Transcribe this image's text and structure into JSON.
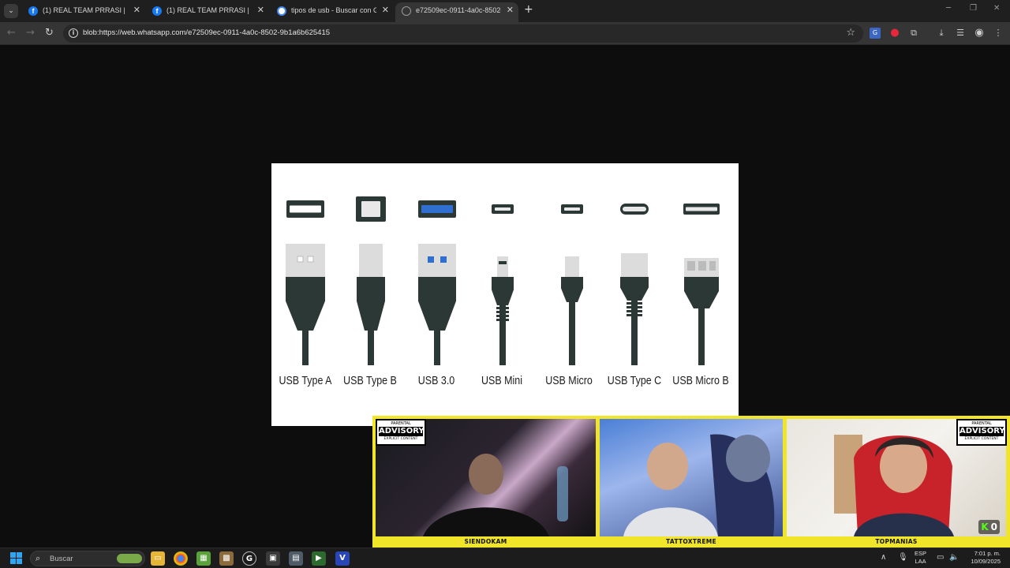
{
  "browser": {
    "tabs": [
      {
        "label": "(1) REAL TEAM PRRASI | Facebook",
        "favicon": "facebook-icon"
      },
      {
        "label": "(1) REAL TEAM PRRASI | Facebook",
        "favicon": "facebook-icon"
      },
      {
        "label": "tipos de usb - Buscar con Google",
        "favicon": "google-icon"
      },
      {
        "label": "e72509ec-0911-4a0c-8502-9b1a6b625415",
        "favicon": "globe-icon",
        "active": true
      }
    ],
    "address": "blob:https://web.whatsapp.com/e72509ec-0911-4a0c-8502-9b1a6b625415"
  },
  "usb_image": {
    "connectors": [
      {
        "label": "USB Type A"
      },
      {
        "label": "USB Type B"
      },
      {
        "label": "USB 3.0"
      },
      {
        "label": "USB Mini"
      },
      {
        "label": "USB Micro"
      },
      {
        "label": "USB Type C"
      },
      {
        "label": "USB Micro B"
      }
    ],
    "colors": {
      "cable": "#2b3835",
      "metal": "#dcdcdc",
      "usb3_blue": "#2f6fd0"
    }
  },
  "stream": {
    "border_color": "#f1e52a",
    "advisory": {
      "line1": "PARENTAL",
      "line2": "ADVISORY",
      "line3": "EXPLICIT CONTENT"
    },
    "streamers": [
      {
        "name": "SIENDOKAM"
      },
      {
        "name": "TATTOXTREME"
      },
      {
        "name": "TOPMANIAS"
      }
    ],
    "kick_count": "0"
  },
  "taskbar": {
    "search_placeholder": "Buscar",
    "lang_line1": "ESP",
    "lang_line2": "LAA",
    "time": "7:01 p. m.",
    "date": "10/09/2025"
  }
}
